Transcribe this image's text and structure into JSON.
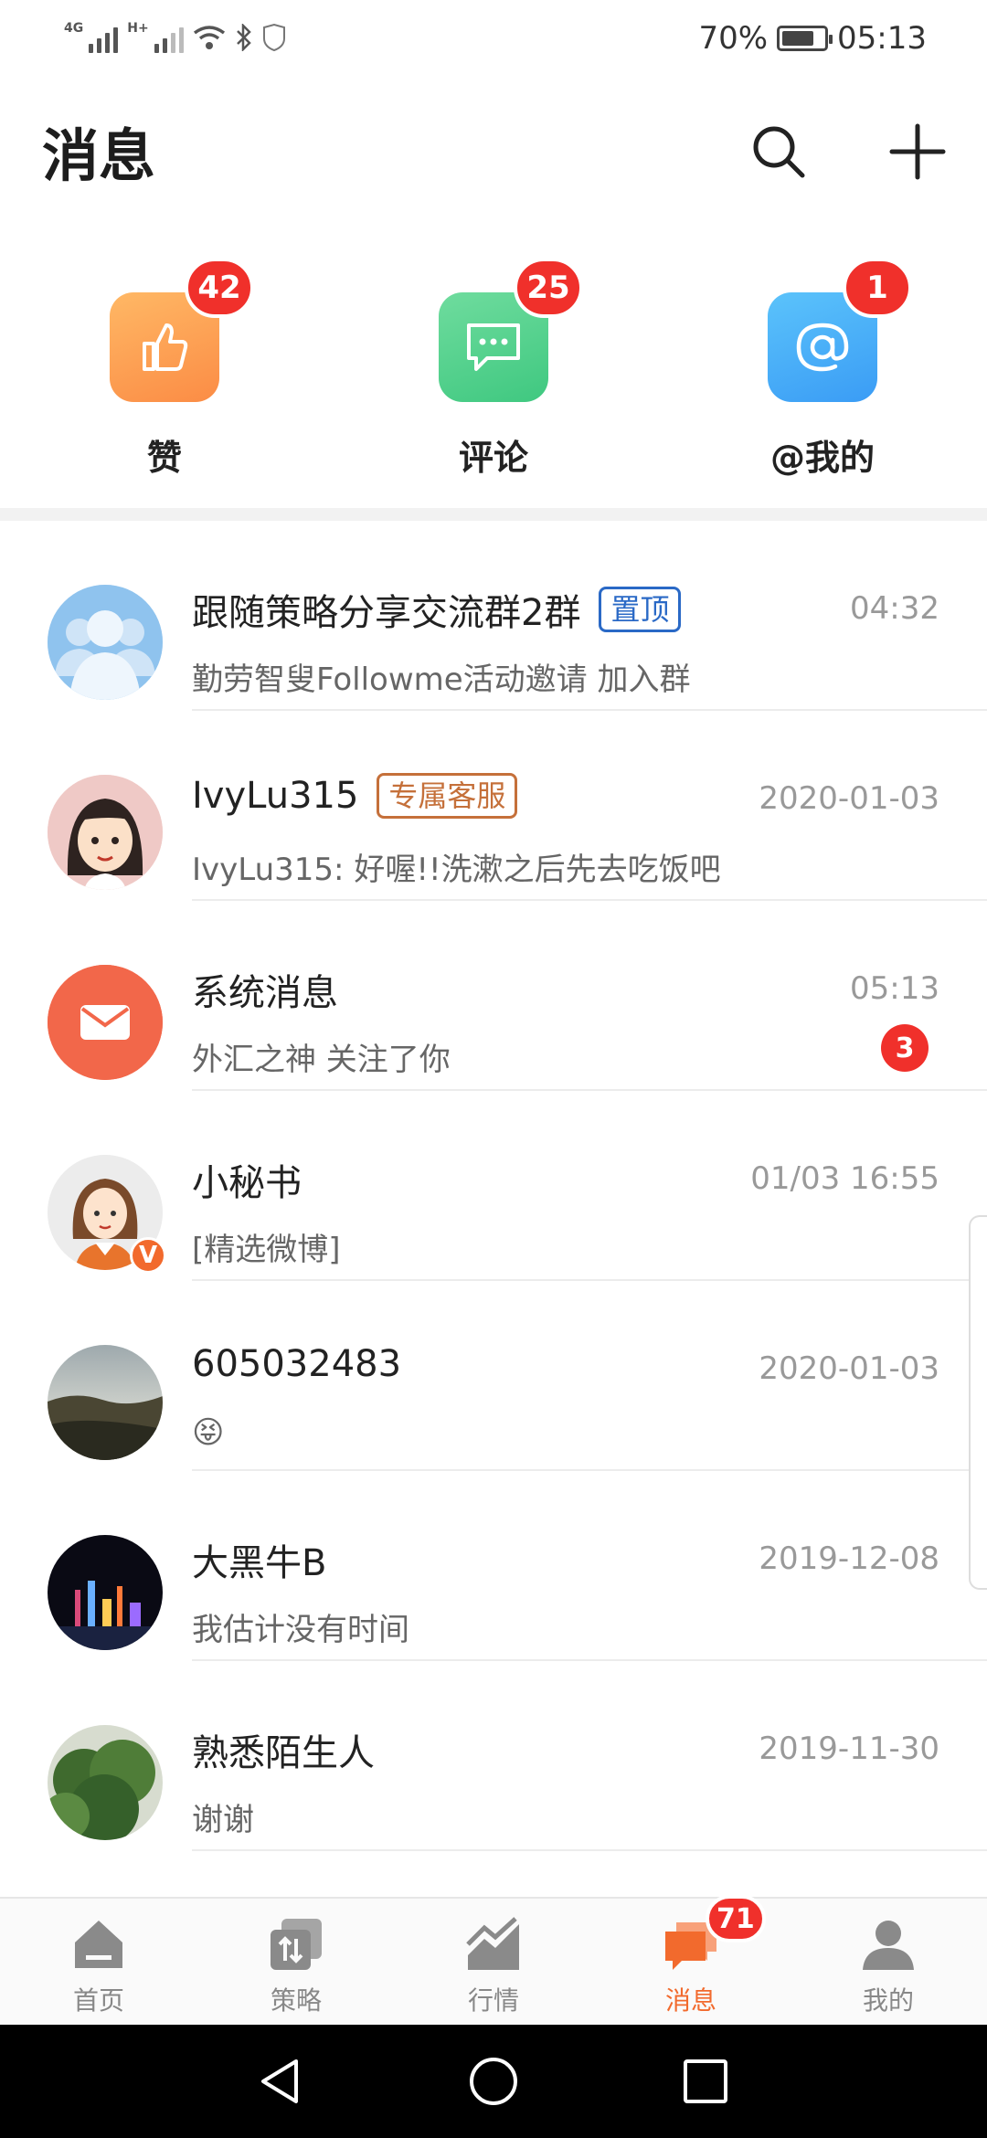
{
  "status_bar": {
    "network_1": "4G",
    "network_2": "H+",
    "battery": "70%",
    "time": "05:13"
  },
  "header": {
    "title": "消息"
  },
  "quick_actions": [
    {
      "label": "赞",
      "badge": "42",
      "color": "#fb8c45",
      "icon": "thumbs-up-icon"
    },
    {
      "label": "评论",
      "badge": "25",
      "color": "#3fc880",
      "icon": "chat-bubble-icon"
    },
    {
      "label": "@我的",
      "badge": "1",
      "color": "#3a9cf5",
      "icon": "at-sign-icon"
    }
  ],
  "conversations": [
    {
      "title": "跟随策略分享交流群2群",
      "tag": "置顶",
      "time": "04:32",
      "preview": "勤劳智叟Followme活动邀请 加入群"
    },
    {
      "title": "IvyLu315",
      "tag": "专属客服",
      "time": "2020-01-03",
      "preview": "IvyLu315: 好喔!!洗漱之后先去吃饭吧"
    },
    {
      "title": "系统消息",
      "time": "05:13",
      "preview": "外汇之神 关注了你",
      "unread": "3"
    },
    {
      "title": "小秘书",
      "time": "01/03 16:55",
      "preview": "[精选微博]",
      "verified": "V"
    },
    {
      "title": "605032483",
      "time": "2020-01-03",
      "preview": "😝"
    },
    {
      "title": "大黑牛B",
      "time": "2019-12-08",
      "preview": "我估计没有时间"
    },
    {
      "title": "熟悉陌生人",
      "time": "2019-11-30",
      "preview": "谢谢"
    }
  ],
  "bottom_nav": [
    {
      "label": "首页",
      "icon": "home-icon"
    },
    {
      "label": "策略",
      "icon": "strategy-icon"
    },
    {
      "label": "行情",
      "icon": "market-chart-icon"
    },
    {
      "label": "消息",
      "icon": "message-icon",
      "badge": "71",
      "active": true
    },
    {
      "label": "我的",
      "icon": "profile-icon"
    }
  ],
  "colors": {
    "accent": "#f26a2d",
    "badge": "#f0302b",
    "tag_blue": "#2a69c6",
    "tag_orange": "#c5703a"
  }
}
